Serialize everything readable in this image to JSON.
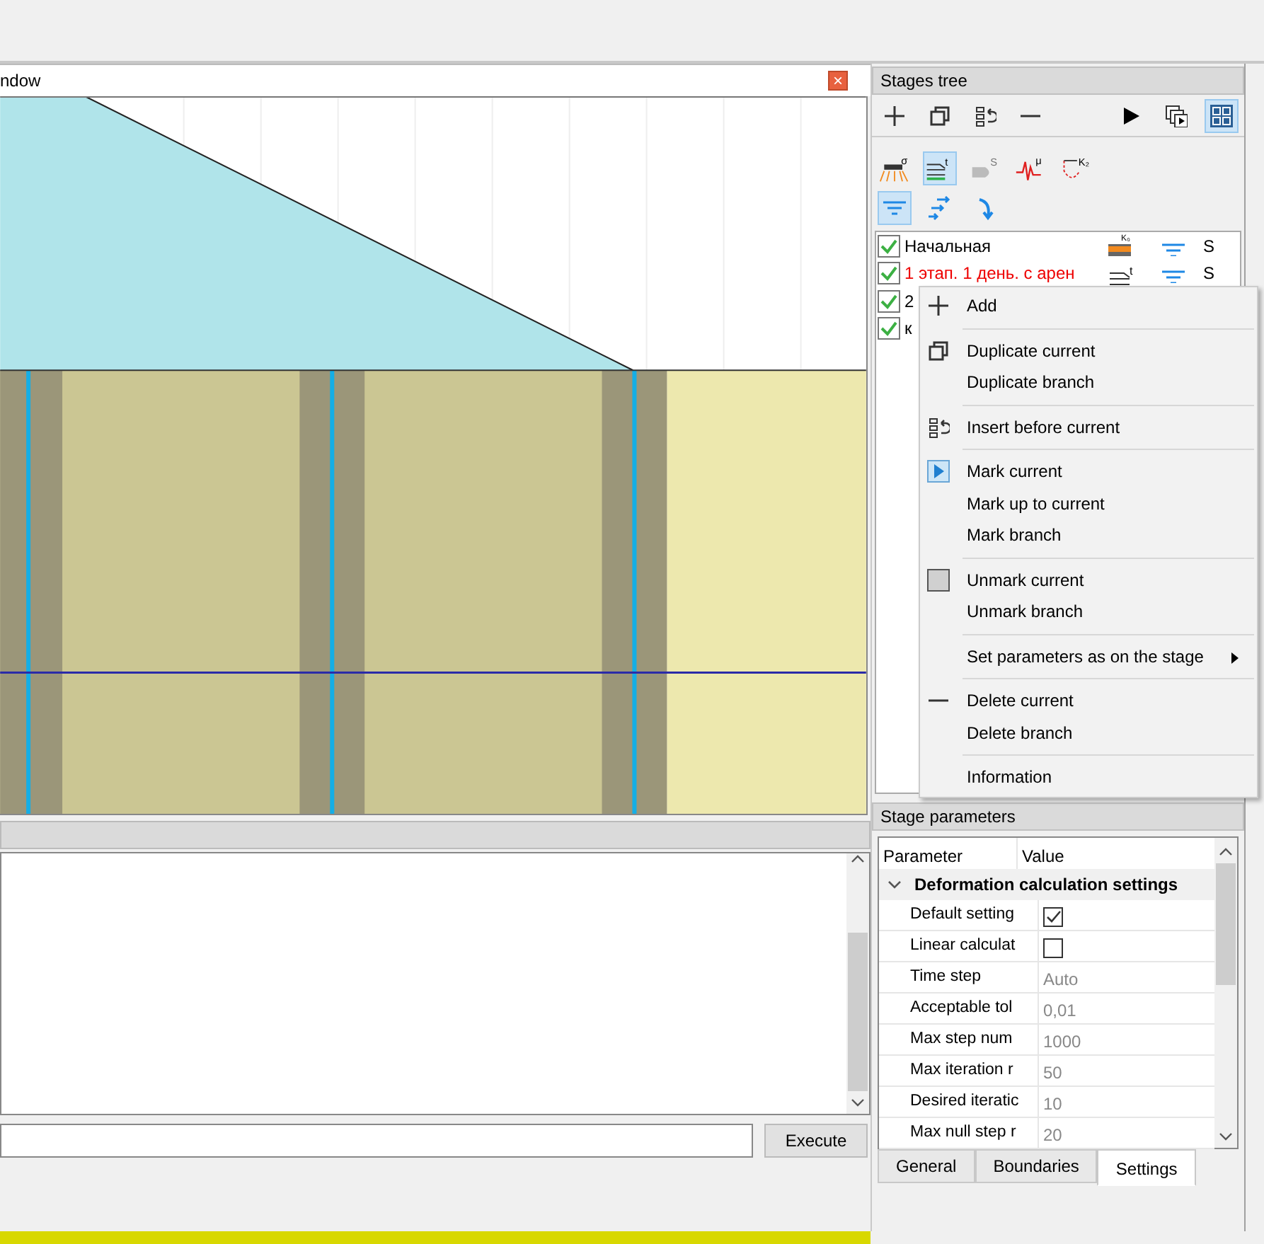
{
  "drawing_window": {
    "title": "ndow",
    "close_label": "×"
  },
  "console": {
    "execute_button": "Execute"
  },
  "stages_tree": {
    "title": "Stages tree",
    "toolbar": [
      {
        "kind": "add"
      },
      {
        "kind": "duplicate"
      },
      {
        "kind": "insert"
      },
      {
        "kind": "delete"
      },
      {
        "kind": "spacer"
      },
      {
        "kind": "run"
      },
      {
        "kind": "run-copy"
      },
      {
        "kind": "grid",
        "selected": true
      }
    ],
    "modes": [
      {
        "kind": "load",
        "label": "σ",
        "selected": false
      },
      {
        "kind": "consolidation",
        "label": "t",
        "selected": true
      },
      {
        "kind": "creep",
        "label": "S",
        "selected": false
      },
      {
        "kind": "seismic",
        "label": "μ",
        "selected": false
      },
      {
        "kind": "dynamic",
        "label": "K₂",
        "selected": false
      }
    ],
    "filters": [
      {
        "kind": "water",
        "selected": true
      },
      {
        "kind": "flow",
        "selected": false
      },
      {
        "kind": "turn",
        "selected": false
      }
    ],
    "stages": [
      {
        "name": "Начальная",
        "checked": true,
        "current": false,
        "kind": "k0",
        "icon_label": "K₀",
        "mark": "S"
      },
      {
        "name": "1 этап. 1 день. с арен",
        "checked": true,
        "current": true,
        "kind": "consolidation",
        "icon_label": "t",
        "mark": "S"
      },
      {
        "name": "2",
        "checked": true,
        "current": false
      },
      {
        "name": "к",
        "checked": true,
        "current": false
      }
    ]
  },
  "context_menu": {
    "groups": [
      [
        {
          "label": "Add",
          "kind": "add"
        }
      ],
      [
        {
          "label": "Duplicate current",
          "kind": "duplicate"
        },
        {
          "label": "Duplicate branch",
          "kind": "plain"
        }
      ],
      [
        {
          "label": "Insert before current",
          "kind": "insert"
        }
      ],
      [
        {
          "label": "Mark current",
          "kind": "mark"
        },
        {
          "label": "Mark up to current",
          "kind": "plain"
        },
        {
          "label": "Mark branch",
          "kind": "plain"
        }
      ],
      [
        {
          "label": "Unmark current",
          "kind": "unmark"
        },
        {
          "label": "Unmark branch",
          "kind": "plain"
        }
      ],
      [
        {
          "label": "Set parameters as on the stage",
          "kind": "plain",
          "submenu": true
        }
      ],
      [
        {
          "label": "Delete current",
          "kind": "delete"
        },
        {
          "label": "Delete branch",
          "kind": "plain"
        }
      ],
      [
        {
          "label": "Information",
          "kind": "plain"
        }
      ]
    ]
  },
  "stage_parameters": {
    "title": "Stage parameters",
    "columns": [
      "Parameter",
      "Value"
    ],
    "group": {
      "label": "Deformation calculation settings",
      "expanded": true
    },
    "rows": [
      {
        "name": "Default setting",
        "kind": "check",
        "checked": true
      },
      {
        "name": "Linear calculat",
        "kind": "check",
        "checked": false
      },
      {
        "name": "Time step",
        "kind": "text",
        "value": "Auto"
      },
      {
        "name": "Acceptable tol",
        "kind": "text",
        "value": "0,01"
      },
      {
        "name": "Max step num",
        "kind": "text",
        "value": "1000"
      },
      {
        "name": "Max iteration r",
        "kind": "text",
        "value": "50"
      },
      {
        "name": "Desired iteratic",
        "kind": "text",
        "value": "10"
      },
      {
        "name": "Max null step r",
        "kind": "text",
        "value": "20"
      }
    ],
    "tabs": [
      {
        "label": "General",
        "selected": false
      },
      {
        "label": "Boundaries",
        "selected": false
      },
      {
        "label": "Settings",
        "selected": true
      }
    ]
  }
}
